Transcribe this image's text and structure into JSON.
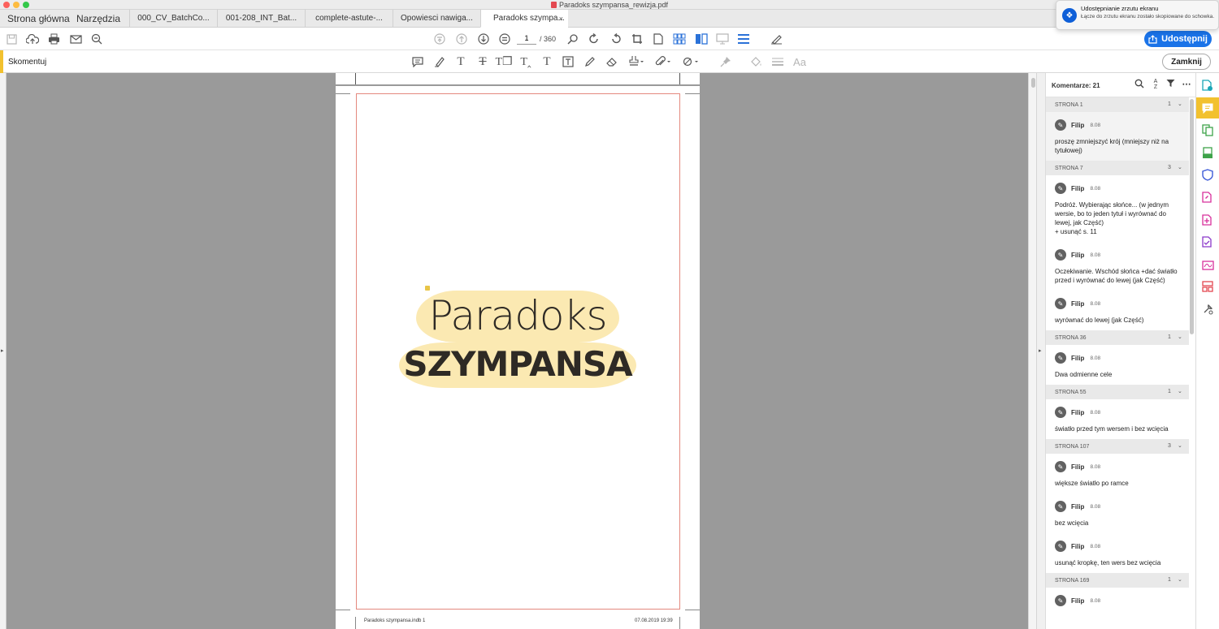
{
  "window": {
    "title": "Paradoks szympansa_rewizja.pdf"
  },
  "nav": {
    "home": "Strona główna",
    "tools": "Narzędzia"
  },
  "tabs": [
    {
      "label": "000_CV_BatchCo..."
    },
    {
      "label": "001-208_INT_Bat..."
    },
    {
      "label": "complete-astute-..."
    },
    {
      "label": "Opowiesci nawiga..."
    },
    {
      "label": "Paradoks szympa...",
      "close": "×"
    }
  ],
  "toolbar": {
    "page_current": "1",
    "page_total": "/ 360",
    "share_label": "Udostępnij"
  },
  "comment_bar": {
    "title": "Skomentuj",
    "close_label": "Zamknij"
  },
  "document": {
    "title_line1": "Paradoks",
    "title_line2": "SZYMPANSA",
    "footer_file": "Paradoks szympansa.indb   1",
    "footer_date": "07.08.2019   19:39"
  },
  "comments_panel": {
    "title": "Komentarze: 21",
    "groups": [
      {
        "page": "STRONA 1",
        "count": "1",
        "comments": [
          {
            "author": "Filip",
            "date": "8.08",
            "text": "proszę zmniejszyć krój (mniejszy niż na tytułowej)"
          }
        ]
      },
      {
        "page": "STRONA 7",
        "count": "3",
        "comments": [
          {
            "author": "Filip",
            "date": "8.08",
            "text": "Podróż. Wybierając słońce... (w jednym wersie, bo to jeden tytuł i wyrównać do lewej, jak Część)\n + usunąć s. 11"
          },
          {
            "author": "Filip",
            "date": "8.08",
            "text": "Oczekiwanie. Wschód słońca +dać światło przed i wyrównać do lewej (jak Część)"
          },
          {
            "author": "Filip",
            "date": "8.08",
            "text": "wyrównać do lewej (jak Część)"
          }
        ]
      },
      {
        "page": "STRONA 36",
        "count": "1",
        "comments": [
          {
            "author": "Filip",
            "date": "8.08",
            "text": "Dwa odmienne cele"
          }
        ]
      },
      {
        "page": "STRONA 55",
        "count": "1",
        "comments": [
          {
            "author": "Filip",
            "date": "8.08",
            "text": "światło przed tym wersem i bez wcięcia"
          }
        ]
      },
      {
        "page": "STRONA 107",
        "count": "3",
        "comments": [
          {
            "author": "Filip",
            "date": "8.08",
            "text": "większe światło po ramce"
          },
          {
            "author": "Filip",
            "date": "8.08",
            "text": "bez wcięcia"
          },
          {
            "author": "Filip",
            "date": "8.08",
            "text": "usunąć kropkę, ten wers bez wcięcia"
          }
        ]
      },
      {
        "page": "STRONA 169",
        "count": "1",
        "comments": [
          {
            "author": "Filip",
            "date": "8.08",
            "text": ""
          }
        ]
      }
    ]
  },
  "notification": {
    "title": "Udostępnianie zrzutu ekranu",
    "body": "Łącze do zrzutu ekranu zostało skopiowane do schowka."
  },
  "colors": {
    "accent_yellow": "#f2c12e",
    "share_blue": "#1a73e8",
    "title_highlight": "#fbe9b2",
    "bleed_red": "#e4897e"
  }
}
